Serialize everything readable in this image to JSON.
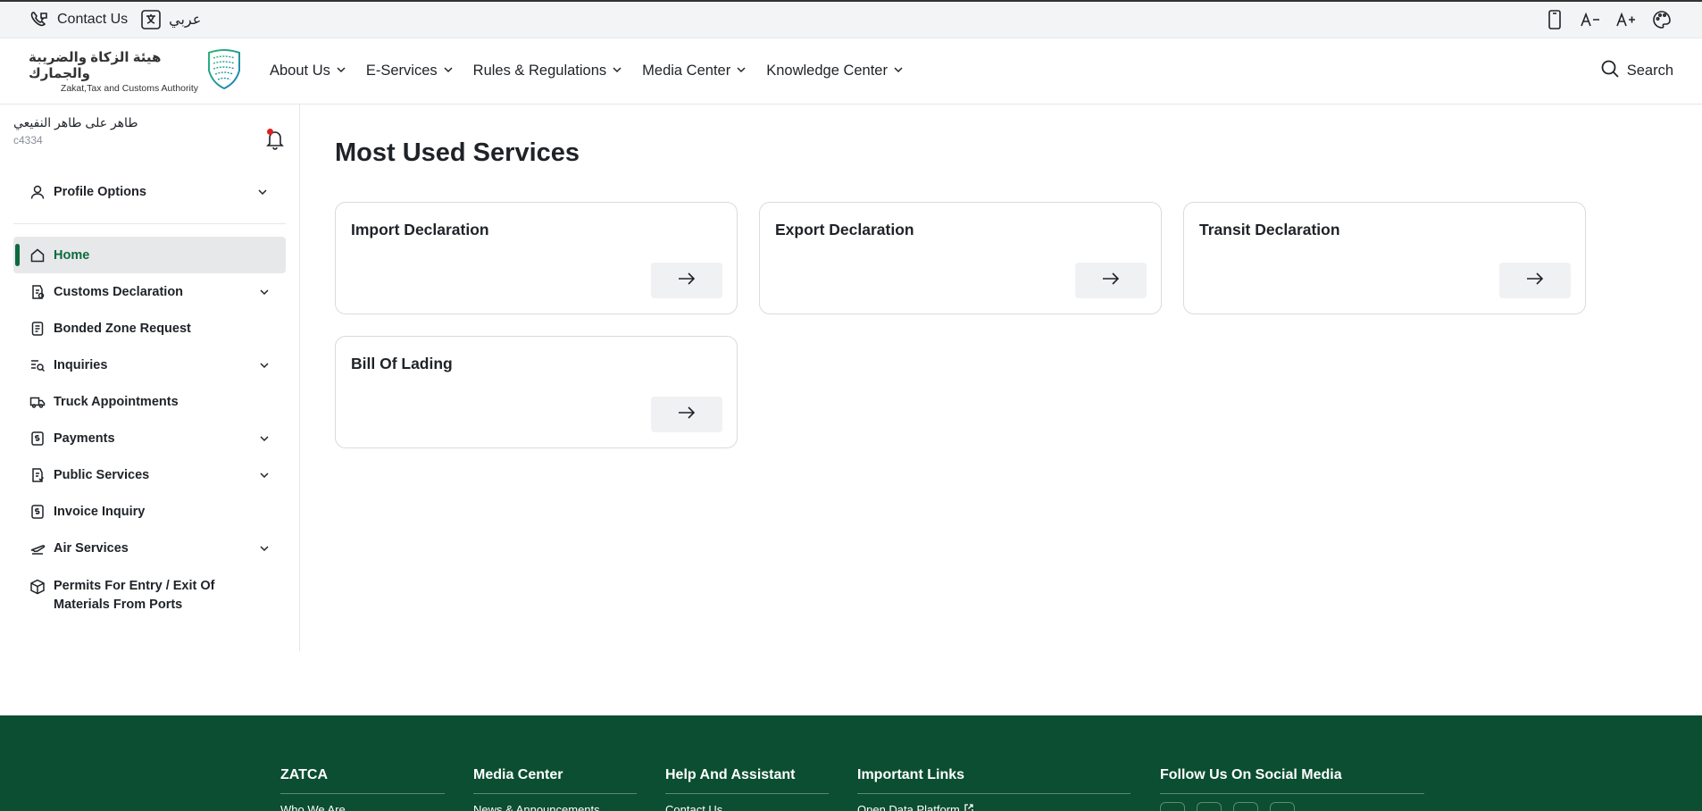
{
  "utility_bar": {
    "contact_label": "Contact Us",
    "language_label": "عربي",
    "icons": [
      "contact-phone-icon",
      "translate-icon",
      "mobile-icon",
      "decrease-font-icon",
      "increase-font-icon",
      "palette-icon"
    ]
  },
  "header": {
    "logo_ar": "هيئة الزكاة والضريبة والجمارك",
    "logo_en": "Zakat,Tax and Customs Authority",
    "nav": [
      "About Us",
      "E-Services",
      "Rules & Regulations",
      "Media Center",
      "Knowledge Center"
    ],
    "search_label": "Search"
  },
  "sidebar": {
    "user_name": "طاهر على طاهر النفيعي",
    "user_id": "c4334",
    "profile_label": "Profile Options",
    "menu": [
      {
        "label": "Home",
        "icon": "home-icon",
        "active": true,
        "chevron": false
      },
      {
        "label": "Customs Declaration",
        "icon": "declaration-icon",
        "active": false,
        "chevron": true
      },
      {
        "label": "Bonded Zone Request",
        "icon": "document-icon",
        "active": false,
        "chevron": false
      },
      {
        "label": "Inquiries",
        "icon": "inquiry-search-icon",
        "active": false,
        "chevron": true
      },
      {
        "label": "Truck Appointments",
        "icon": "truck-icon",
        "active": false,
        "chevron": false
      },
      {
        "label": "Payments",
        "icon": "payment-icon",
        "active": false,
        "chevron": true
      },
      {
        "label": "Public Services",
        "icon": "public-services-icon",
        "active": false,
        "chevron": true
      },
      {
        "label": "Invoice Inquiry",
        "icon": "invoice-icon",
        "active": false,
        "chevron": false
      },
      {
        "label": "Air Services",
        "icon": "airplane-icon",
        "active": false,
        "chevron": true
      },
      {
        "label": "Permits For Entry / Exit Of Materials From Ports",
        "icon": "package-icon",
        "active": false,
        "chevron": false
      }
    ]
  },
  "main": {
    "title": "Most Used Services",
    "cards": [
      "Import Declaration",
      "Export Declaration",
      "Transit Declaration",
      "Bill Of Lading"
    ]
  },
  "footer": {
    "columns": [
      {
        "title": "ZATCA",
        "first_link": "Who We Are"
      },
      {
        "title": "Media Center",
        "first_link": "News & Announcements"
      },
      {
        "title": "Help And Assistant",
        "first_link": "Contact Us"
      },
      {
        "title": "Important Links",
        "first_link": "Open Data Platform"
      },
      {
        "title": "Follow Us On Social Media",
        "first_link": ""
      }
    ]
  },
  "colors": {
    "brand_green": "#0d6b3e",
    "footer_green": "#0b4e32",
    "notification_red": "#e02020"
  }
}
